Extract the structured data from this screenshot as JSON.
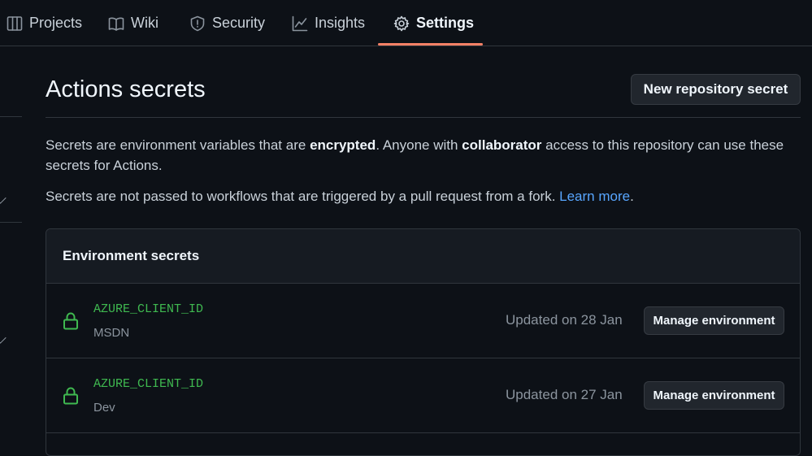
{
  "nav": {
    "tabs": [
      {
        "label": "Projects",
        "icon": "project-table-icon"
      },
      {
        "label": "Wiki",
        "icon": "book-icon"
      },
      {
        "label": "Security",
        "icon": "shield-icon"
      },
      {
        "label": "Insights",
        "icon": "graph-icon"
      },
      {
        "label": "Settings",
        "icon": "gear-icon",
        "selected": true
      }
    ]
  },
  "page": {
    "title": "Actions secrets",
    "new_secret_label": "New repository secret",
    "intro": {
      "part1": "Secrets are environment variables that are ",
      "bold1": "encrypted",
      "part2": ". Anyone with ",
      "bold2": "collaborator",
      "part3": " access to this repository can use these secrets for Actions."
    },
    "fork_note": {
      "text": "Secrets are not passed to workflows that are triggered by a pull request from a fork. ",
      "link": "Learn more",
      "end": "."
    }
  },
  "environment_secrets": {
    "title": "Environment secrets",
    "rows": [
      {
        "name": "AZURE_CLIENT_ID",
        "environment": "MSDN",
        "updated": "Updated on 28 Jan",
        "action": "Manage environment"
      },
      {
        "name": "AZURE_CLIENT_ID",
        "environment": "Dev",
        "updated": "Updated on 27 Jan",
        "action": "Manage environment"
      }
    ]
  },
  "colors": {
    "background": "#0d1117",
    "accent_underline": "#f78166",
    "secret_green": "#3fb950",
    "link_blue": "#58a6ff"
  }
}
